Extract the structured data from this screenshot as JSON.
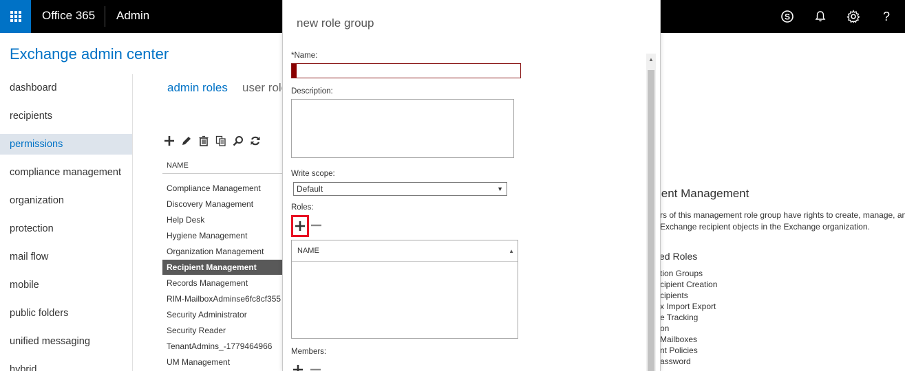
{
  "topbar": {
    "brand": "Office 365",
    "section": "Admin",
    "icons": [
      "waffle-icon",
      "skype-icon",
      "bell-icon",
      "gear-icon",
      "help-icon"
    ],
    "help_glyph": "?"
  },
  "page": {
    "title": "Exchange admin center"
  },
  "nav": {
    "items": [
      {
        "label": "dashboard"
      },
      {
        "label": "recipients"
      },
      {
        "label": "permissions",
        "active": true
      },
      {
        "label": "compliance management"
      },
      {
        "label": "organization"
      },
      {
        "label": "protection"
      },
      {
        "label": "mail flow"
      },
      {
        "label": "mobile"
      },
      {
        "label": "public folders"
      },
      {
        "label": "unified messaging"
      },
      {
        "label": "hybrid"
      }
    ]
  },
  "tabs": {
    "admin_roles": "admin roles",
    "user_roles": "user roles"
  },
  "toolbar": {
    "icons": [
      "add-icon",
      "edit-icon",
      "delete-icon",
      "copy-icon",
      "search-icon",
      "refresh-icon"
    ]
  },
  "list": {
    "header": "NAME",
    "rows": [
      "Compliance Management",
      "Discovery Management",
      "Help Desk",
      "Hygiene Management",
      "Organization Management",
      "Recipient Management",
      "Records Management",
      "RIM-MailboxAdminse6fc8cf355",
      "Security Administrator",
      "Security Reader",
      "TenantAdmins_-1779464966",
      "UM Management"
    ],
    "selected_index": 5
  },
  "detail": {
    "title": "ient Management",
    "description_line1": "rs of this management role group have rights to create, manage, an",
    "description_line2": " Exchange recipient objects in the Exchange organization.",
    "assigned_roles_heading": "ed Roles",
    "roles": [
      "tion Groups",
      "cipient Creation",
      "cipients",
      "x Import Export",
      "e Tracking",
      "on",
      "Mailboxes",
      "nt Policies",
      "assword"
    ]
  },
  "dialog": {
    "title": "new role group",
    "name_label": "*Name:",
    "name_value": "",
    "description_label": "Description:",
    "description_value": "",
    "write_scope_label": "Write scope:",
    "write_scope_value": "Default",
    "roles_label": "Roles:",
    "roles_table_header": "NAME",
    "members_label": "Members:",
    "colors": {
      "error": "#8b0000",
      "highlight": "#e81123",
      "accent": "#0072c6"
    }
  }
}
